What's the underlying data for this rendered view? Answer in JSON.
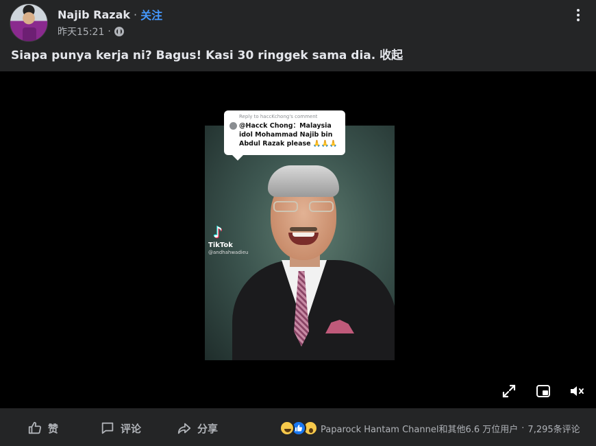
{
  "post": {
    "author": "Najib Razak",
    "separator": "·",
    "follow_label": "关注",
    "timestamp": "昨天15:21",
    "meta_separator": "·",
    "caption": "Siapa punya kerja ni? Bagus! Kasi 30 ringgek sama dia.",
    "collapse_label": "收起"
  },
  "video": {
    "comment_bubble": {
      "reply_line": "Reply to haccKchong's comment",
      "text": "@Hacck Chong：Malaysia idol Mohammad Najib bin Abdul Razak please 🙏🙏🙏"
    },
    "watermark": {
      "brand": "TikTok",
      "handle": "@andhahwadieu"
    },
    "controls": [
      "expand-icon",
      "pip-icon",
      "mute-icon"
    ]
  },
  "actions": {
    "like_label": "赞",
    "comment_label": "评论",
    "share_label": "分享"
  },
  "engagement": {
    "reaction_icons": [
      "haha",
      "like",
      "wow"
    ],
    "reactions_text": "Paparock Hantam Channel和其他6.6 万位用户",
    "separator": "·",
    "comments_text": "7,295条评论"
  },
  "colors": {
    "background": "#242526",
    "video_background": "#000000",
    "link_blue": "#4599ff",
    "secondary_text": "#b0b3b8",
    "primary_text": "#e4e6eb"
  }
}
